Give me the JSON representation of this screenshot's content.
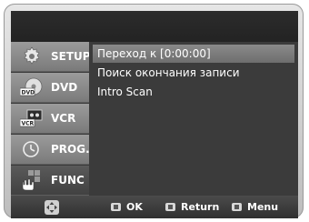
{
  "sidebar": {
    "items": [
      {
        "label": "SETUP",
        "icon": "gear-icon"
      },
      {
        "label": "DVD",
        "icon": "dvd-disc-icon"
      },
      {
        "label": "VCR",
        "icon": "vcr-cassette-icon"
      },
      {
        "label": "PROG.",
        "icon": "clock-icon"
      },
      {
        "label": "FUNC",
        "icon": "func-hand-icon"
      }
    ]
  },
  "menu": {
    "items": [
      {
        "label": "Переход к [0:00:00]"
      },
      {
        "label": "Поиск окончания записи"
      },
      {
        "label": "Intro Scan"
      }
    ]
  },
  "footer": {
    "ok_label": "OK",
    "return_label": "Return",
    "menu_label": "Menu"
  },
  "icon_text": {
    "dvd": "DVD",
    "vcr": "VCR"
  }
}
